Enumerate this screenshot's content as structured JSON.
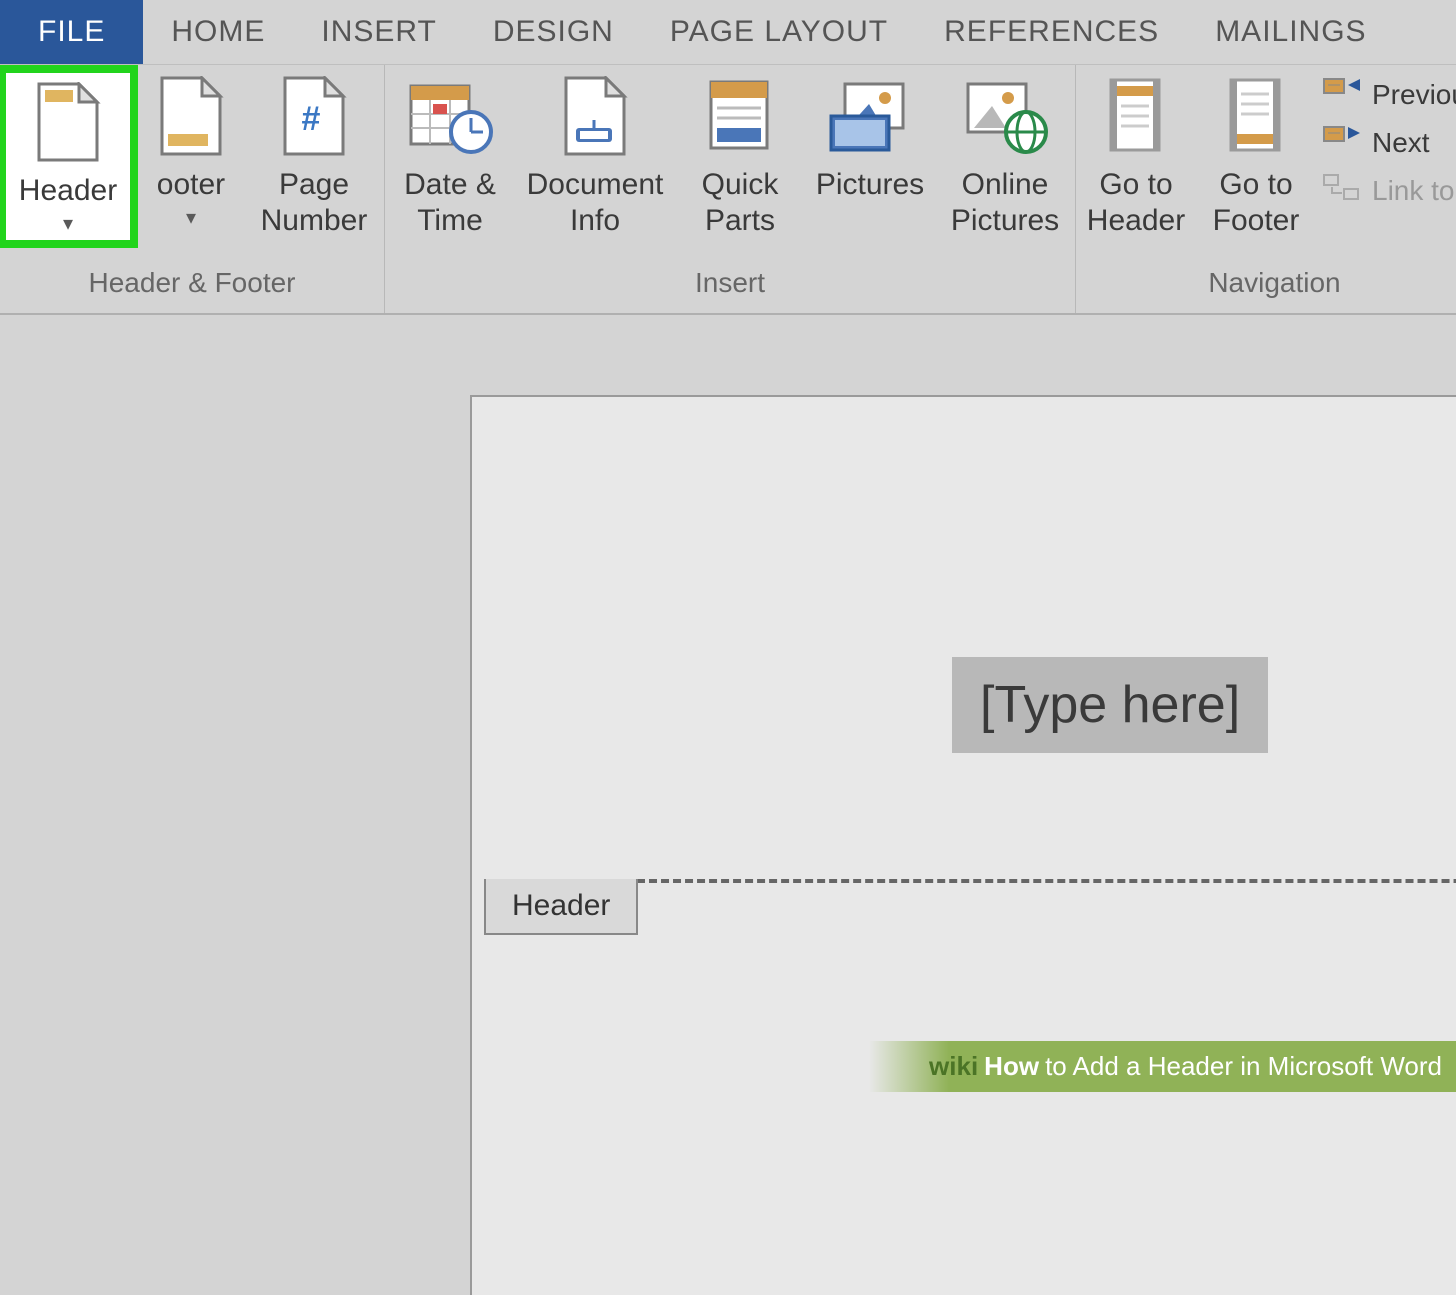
{
  "tabs": {
    "file": "FILE",
    "home": "HOME",
    "insert": "INSERT",
    "design": "DESIGN",
    "page_layout": "PAGE LAYOUT",
    "references": "REFERENCES",
    "mailings": "MAILINGS"
  },
  "ribbon": {
    "header_footer_group": "Header & Footer",
    "insert_group": "Insert",
    "navigation_group": "Navigation",
    "header": "Header",
    "footer": "ooter",
    "page_number": "Page\nNumber",
    "date_time": "Date &\nTime",
    "document_info": "Document\nInfo",
    "quick_parts": "Quick\nParts",
    "pictures": "Pictures",
    "online_pictures": "Online\nPictures",
    "go_to_header": "Go to\nHeader",
    "go_to_footer": "Go to\nFooter",
    "previous": "Previou",
    "next": "Next",
    "link_to": "Link to"
  },
  "document": {
    "placeholder": "[Type here]",
    "header_tag": "Header"
  },
  "watermark": {
    "wiki": "wiki",
    "how": "How",
    "title": " to Add a Header in Microsoft Word"
  },
  "dropdown_arrow": "▾"
}
